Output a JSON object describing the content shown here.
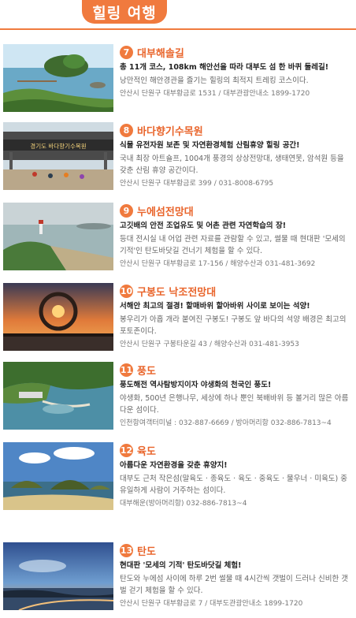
{
  "header": {
    "title": "힐링 여행"
  },
  "items": [
    {
      "num": "7",
      "name": "대부해솔길",
      "tagline": "총 11개 코스, 108km 해안선을 따라 대부도 섬 한 바퀴 둘레길!",
      "desc": "낭만적인 해안경관을 즐기는 힐링의 최적지 트레킹 코스이다.",
      "addr": "안산시 단원구 대부황금로 1531 / 대부관광안내소 1899-1720"
    },
    {
      "num": "8",
      "name": "바다향기수목원",
      "tagline": "식물 유전자원 보존 및 자연환경체험 산림휴양 힐링 공간!",
      "desc": "국내 최장 아트숄프, 1004개 풍경의 상상전망대, 생태연못, 암석원 등을 갖춘 산림 휴양 공간이다.",
      "addr": "안산시 단원구 대부황금로 399 / 031-8008-6795",
      "sign": "경기도 바다향기수목원"
    },
    {
      "num": "9",
      "name": "누에섬전망대",
      "tagline": "고깃배의 안전 조업유도 및 어촌 관련 자연학습의 장!",
      "desc": "등대 전시실 내 어업 관련 자료를 관람할 수 있고, 썰물 때 현대판 '모세의 기적'인 탄도바닷길 건너기 체험을 할 수 있다.",
      "addr": "안산시 단원구 대부황금로 17-156 / 해양수산과 031-481-3692"
    },
    {
      "num": "10",
      "name": "구봉도 낙조전망대",
      "tagline": "서해안 최고의 절경! 할매바위 할아바위 사이로 보이는 석양!",
      "desc": "봉우리가 아홉 개라 붙여진 구봉도! 구봉도 앞 바다의 석양 배경은 최고의 포토존이다.",
      "addr": "안산시 단원구 구봉타운길 43 / 해양수산과 031-481-3953"
    },
    {
      "num": "11",
      "name": "풍도",
      "tagline": "풍도해전 역사탐방지이자 야생화의 천국인 풍도!",
      "desc": "야생화, 500년 은행나무, 세상에 하나 뿐인 북배바위 등 볼거리 많은 아름다운 섬이다.",
      "addr": "인천항여객터미널 : 032-887-6669 / 방아머리항 032-886-7813~4"
    },
    {
      "num": "12",
      "name": "육도",
      "tagline": "아름다운 자연환경을 갖춘 휴양지!",
      "desc": "대부도 근처 작은섬(말육도 · 종육도 · 육도 · 중육도 · 물우너 · 미육도) 중 유일하게 사람이 거주하는 섬이다.",
      "addr": "대부해운(방아머리항) 032-886-7813~4"
    },
    {
      "num": "13",
      "name": "탄도",
      "tagline": "현대판 '모세의 기적' 탄도바닷길 체험!",
      "desc": "탄도와 누에섬 사이에 하루 2번 썰물 때 4시간씩 갯벌이 드러나 신비한 갯벌 걷기 체험을 할 수 있다.",
      "addr": "안산시 단원구 대부황금로 7 / 대부도관광안내소 1899-1720"
    }
  ]
}
